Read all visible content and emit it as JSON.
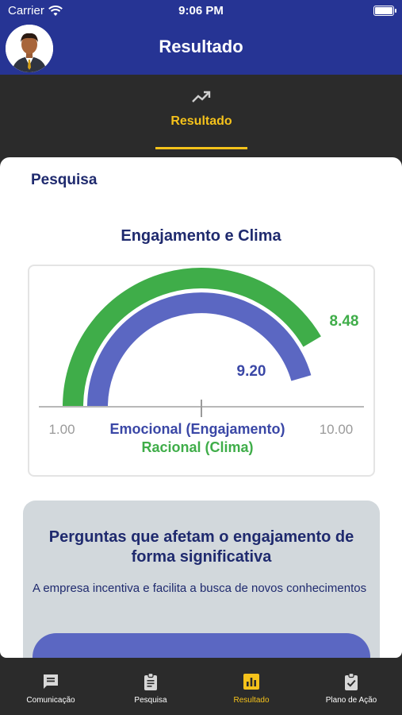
{
  "status_bar": {
    "carrier": "Carrier",
    "time": "9:06 PM"
  },
  "header": {
    "title": "Resultado"
  },
  "tab": {
    "label": "Resultado"
  },
  "section": {
    "title": "Pesquisa"
  },
  "chart_data": {
    "type": "gauge",
    "title": "Engajamento e Clima",
    "min_label": "1.00",
    "max_label": "10.00",
    "min": 1,
    "max": 10,
    "series": [
      {
        "name": "Emocional (Engajamento)",
        "value": 9.2,
        "value_label": "9.20",
        "color": "#5b67c2"
      },
      {
        "name": "Racional (Clima)",
        "value": 8.48,
        "value_label": "8.48",
        "color": "#3fad49"
      }
    ]
  },
  "questions": {
    "title": "Perguntas que afetam o engajamento de forma significativa",
    "items": [
      "A empresa incentiva e facilita a busca de novos conhecimentos"
    ]
  },
  "bottom_nav": {
    "items": [
      {
        "label": "Comunicação",
        "icon": "chat-icon"
      },
      {
        "label": "Pesquisa",
        "icon": "clipboard-icon"
      },
      {
        "label": "Resultado",
        "icon": "bar-chart-icon"
      },
      {
        "label": "Plano de Ação",
        "icon": "clipboard-check-icon"
      }
    ]
  },
  "colors": {
    "primary": "#263494",
    "accent": "#f5c21b",
    "green": "#3fad49",
    "blue": "#5b67c2"
  }
}
